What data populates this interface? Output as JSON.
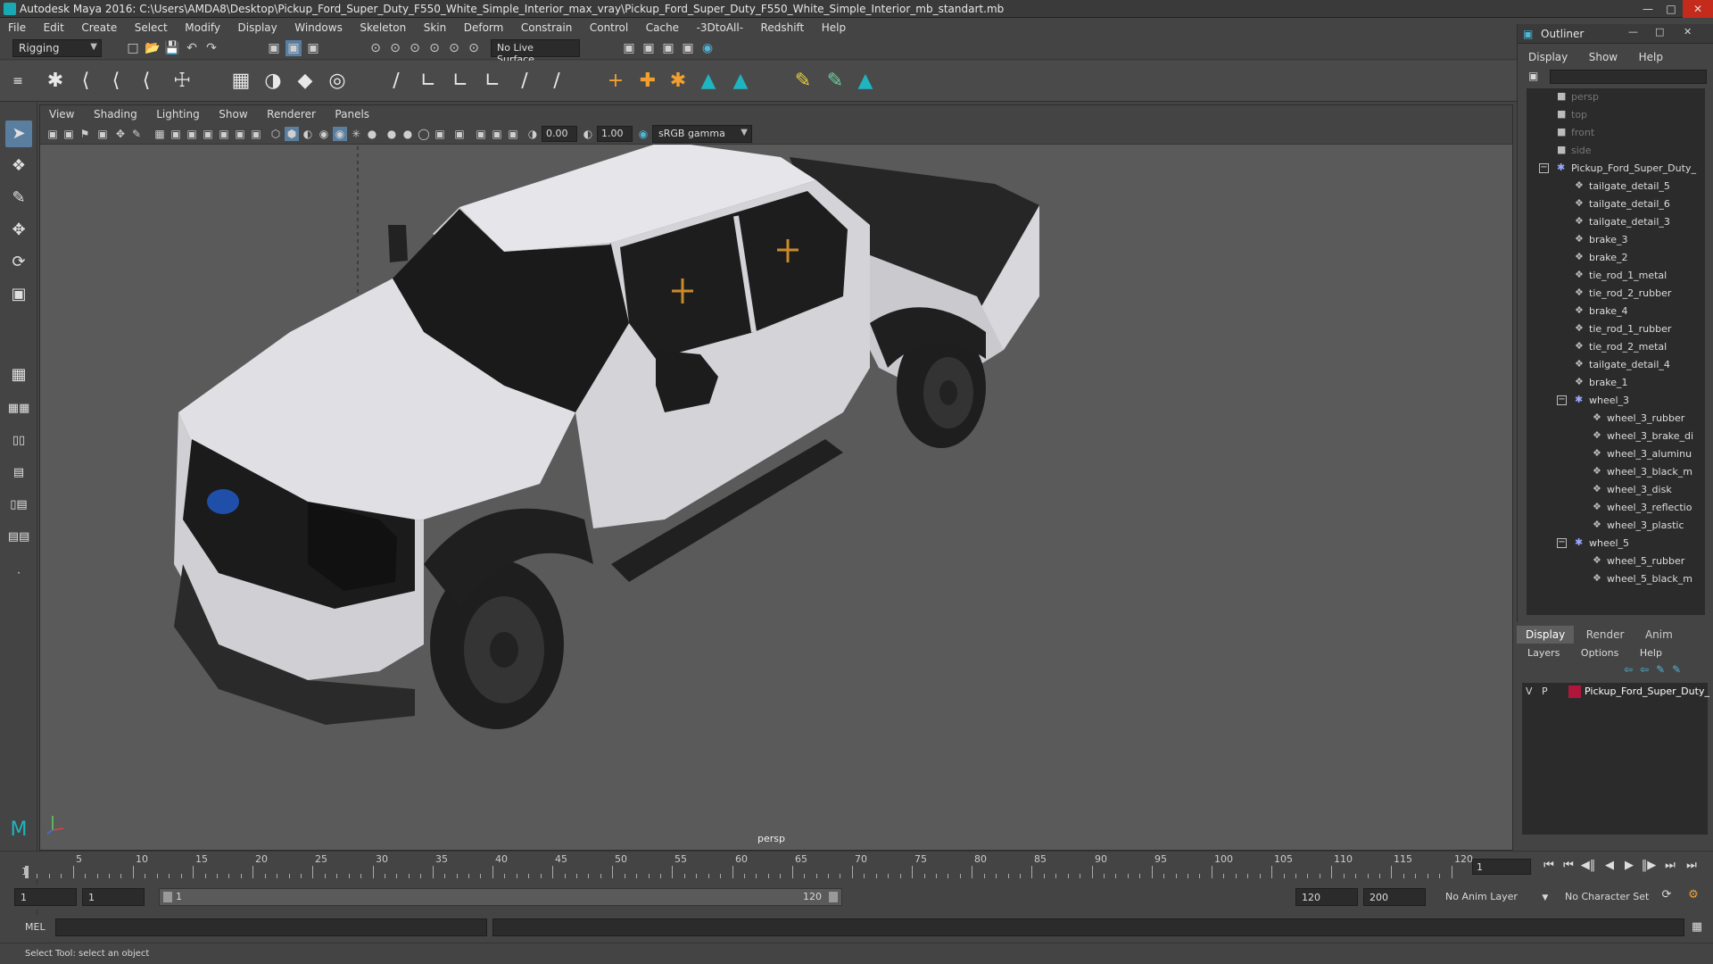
{
  "window": {
    "title": "Autodesk Maya 2016: C:\\Users\\AMDA8\\Desktop\\Pickup_Ford_Super_Duty_F550_White_Simple_Interior_max_vray\\Pickup_Ford_Super_Duty_F550_White_Simple_Interior_mb_standart.mb",
    "minimize_icon": "minimize-icon",
    "maximize_icon": "maximize-icon",
    "close_icon": "close-icon"
  },
  "menubar": [
    "File",
    "Edit",
    "Create",
    "Select",
    "Modify",
    "Display",
    "Windows",
    "Skeleton",
    "Skin",
    "Deform",
    "Constrain",
    "Control",
    "Cache",
    "-3DtoAll-",
    "Redshift",
    "Help"
  ],
  "statusline": {
    "menu_set": "Rigging",
    "live_surface": "No Live Surface"
  },
  "viewport": {
    "menu": [
      "View",
      "Shading",
      "Lighting",
      "Show",
      "Renderer",
      "Panels"
    ],
    "exposure": "0.00",
    "gamma": "1.00",
    "color_space": "sRGB gamma",
    "camera_label": "persp",
    "scene_description_icon": "pickup-truck-3d-model"
  },
  "outliner": {
    "title": "Outliner",
    "menu": [
      "Display",
      "Show",
      "Help"
    ],
    "items": [
      {
        "label": "persp",
        "icon": "camera-icon",
        "depth": 0,
        "dim": true
      },
      {
        "label": "top",
        "icon": "camera-icon",
        "depth": 0,
        "dim": true
      },
      {
        "label": "front",
        "icon": "camera-icon",
        "depth": 0,
        "dim": true
      },
      {
        "label": "side",
        "icon": "camera-icon",
        "depth": 0,
        "dim": true
      },
      {
        "label": "Pickup_Ford_Super_Duty_",
        "icon": "group-icon",
        "depth": 0,
        "expand": "−"
      },
      {
        "label": "tailgate_detail_5",
        "icon": "mesh-icon",
        "depth": 1
      },
      {
        "label": "tailgate_detail_6",
        "icon": "mesh-icon",
        "depth": 1
      },
      {
        "label": "tailgate_detail_3",
        "icon": "mesh-icon",
        "depth": 1
      },
      {
        "label": "brake_3",
        "icon": "mesh-icon",
        "depth": 1
      },
      {
        "label": "brake_2",
        "icon": "mesh-icon",
        "depth": 1
      },
      {
        "label": "tie_rod_1_metal",
        "icon": "mesh-icon",
        "depth": 1
      },
      {
        "label": "tie_rod_2_rubber",
        "icon": "mesh-icon",
        "depth": 1
      },
      {
        "label": "brake_4",
        "icon": "mesh-icon",
        "depth": 1
      },
      {
        "label": "tie_rod_1_rubber",
        "icon": "mesh-icon",
        "depth": 1
      },
      {
        "label": "tie_rod_2_metal",
        "icon": "mesh-icon",
        "depth": 1
      },
      {
        "label": "tailgate_detail_4",
        "icon": "mesh-icon",
        "depth": 1
      },
      {
        "label": "brake_1",
        "icon": "mesh-icon",
        "depth": 1
      },
      {
        "label": "wheel_3",
        "icon": "group-icon",
        "depth": 1,
        "expand": "−"
      },
      {
        "label": "wheel_3_rubber",
        "icon": "mesh-icon",
        "depth": 2
      },
      {
        "label": "wheel_3_brake_di",
        "icon": "mesh-icon",
        "depth": 2
      },
      {
        "label": "wheel_3_aluminu",
        "icon": "mesh-icon",
        "depth": 2
      },
      {
        "label": "wheel_3_black_m",
        "icon": "mesh-icon",
        "depth": 2
      },
      {
        "label": "wheel_3_disk",
        "icon": "mesh-icon",
        "depth": 2
      },
      {
        "label": "wheel_3_reflectio",
        "icon": "mesh-icon",
        "depth": 2
      },
      {
        "label": "wheel_3_plastic",
        "icon": "mesh-icon",
        "depth": 2
      },
      {
        "label": "wheel_5",
        "icon": "group-icon",
        "depth": 1,
        "expand": "−"
      },
      {
        "label": "wheel_5_rubber",
        "icon": "mesh-icon",
        "depth": 2
      },
      {
        "label": "wheel_5_black_m",
        "icon": "mesh-icon",
        "depth": 2
      }
    ]
  },
  "layers": {
    "tabs": [
      "Display",
      "Render",
      "Anim"
    ],
    "menu": [
      "Layers",
      "Options",
      "Help"
    ],
    "rows": [
      {
        "v": "V",
        "p": "P",
        "name": "Pickup_Ford_Super_Duty_",
        "color": "#b0163a"
      }
    ]
  },
  "timeline": {
    "ticks": [
      "5",
      "10",
      "15",
      "20",
      "25",
      "30",
      "35",
      "40",
      "45",
      "50",
      "55",
      "60",
      "65",
      "70",
      "75",
      "80",
      "85",
      "90",
      "95",
      "100",
      "105",
      "110",
      "115",
      "120"
    ],
    "start_label": "1",
    "current_frame": "1"
  },
  "range": {
    "start": "1",
    "anim_start": "1",
    "range_start": "1",
    "range_end": "120",
    "end": "120",
    "anim_end": "200",
    "anim_layer": "No Anim Layer",
    "character_set": "No Character Set"
  },
  "cmdline": {
    "label": "MEL"
  },
  "helpline": {
    "text": "Select Tool: select an object"
  },
  "colors": {
    "accent": "#5a7ea0",
    "layer_color": "#b0163a",
    "viewport_bg": "#5a5a5a"
  }
}
